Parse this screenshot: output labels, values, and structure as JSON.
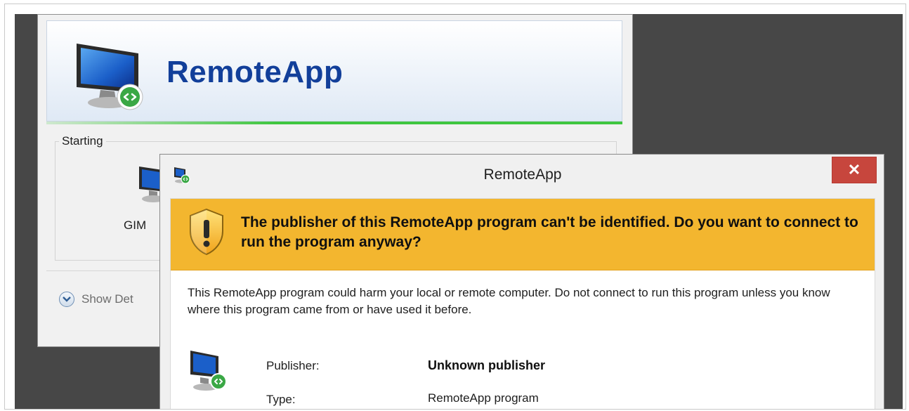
{
  "background_window": {
    "banner_title": "RemoteApp",
    "group_label": "Starting",
    "program_name": "GIM",
    "show_details": "Show Det"
  },
  "dialog": {
    "title": "RemoteApp",
    "close_glyph": "✕",
    "warning": "The publisher of this RemoteApp program can't be identified. Do you want to connect to run the program anyway?",
    "description": "This RemoteApp program could harm your local or remote computer. Do not connect to run this program unless you know where this program came from or have used it before.",
    "publisher_label": "Publisher:",
    "publisher_value": "Unknown publisher",
    "type_label": "Type:",
    "type_value": "RemoteApp program"
  },
  "icons": [
    "remoteapp-monitor-icon",
    "shield-warning-icon",
    "expand-chevron-icon",
    "close-icon"
  ],
  "colors": {
    "warning_bar": "#f3b62f",
    "close_button": "#c7463d",
    "banner_title": "#123f9a",
    "progress_line": "#3fc63f",
    "desktop": "#474747"
  }
}
